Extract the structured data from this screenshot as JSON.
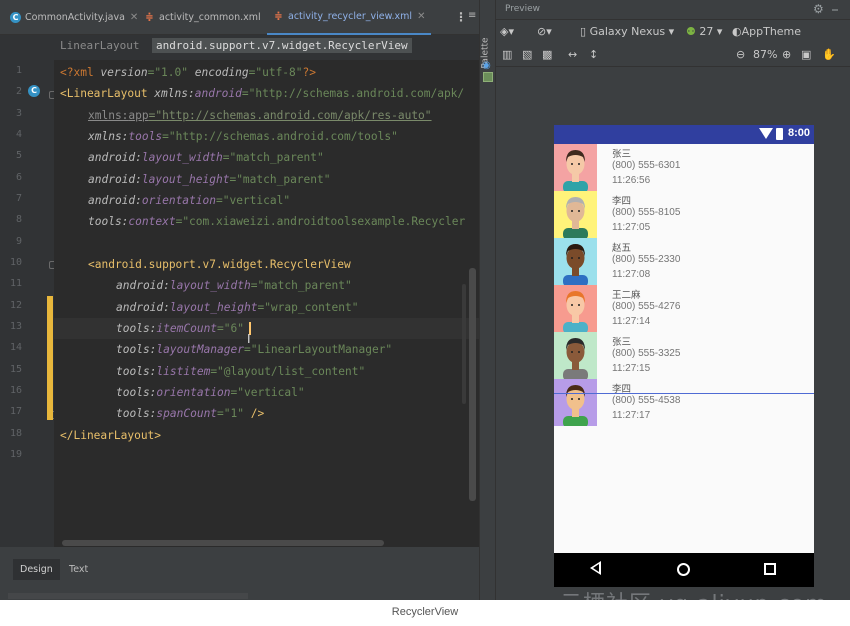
{
  "editor": {
    "tabs": [
      {
        "label": "CommonActivity.java",
        "icon": "java-class-icon"
      },
      {
        "label": "activity_common.xml",
        "icon": "layout-xml-icon"
      },
      {
        "label": "activity_recycler_view.xml",
        "icon": "layout-xml-icon",
        "active": true
      }
    ],
    "breadcrumb": [
      "LinearLayout",
      "android.support.v7.widget.RecyclerView"
    ],
    "line_numbers": [
      "1",
      "2",
      "3",
      "4",
      "5",
      "6",
      "7",
      "8",
      "9",
      "10",
      "11",
      "12",
      "13",
      "14",
      "15",
      "16",
      "17",
      "18",
      "19"
    ],
    "code": {
      "l1_pi": "<?xml ",
      "l1_a1": "version",
      "l1_v1": "=\"1.0\" ",
      "l1_a2": "encoding",
      "l1_v2": "=\"utf-8\"",
      "l1_end": "?>",
      "l2_tag": "<LinearLayout ",
      "l2_ns": "xmlns:",
      "l2_attr": "android",
      "l2_val": "=\"http://schemas.android.com/apk/",
      "l3_ns": "xmlns:",
      "l3_attr": "app",
      "l3_val": "=\"http://schemas.android.com/apk/res-auto\"",
      "l4_ns": "xmlns:",
      "l4_attr": "tools",
      "l4_val": "=\"http://schemas.android.com/tools\"",
      "l5_ns": "android:",
      "l5_attr": "layout_width",
      "l5_val": "=\"match_parent\"",
      "l6_ns": "android:",
      "l6_attr": "layout_height",
      "l6_val": "=\"match_parent\"",
      "l7_ns": "android:",
      "l7_attr": "orientation",
      "l7_val": "=\"vertical\"",
      "l8_ns": "tools:",
      "l8_attr": "context",
      "l8_val": "=\"com.xiaweizi.androidtoolsexample.Recycler",
      "l10_tag": "<android.support.v7.widget.RecyclerView",
      "l11_ns": "android:",
      "l11_attr": "layout_width",
      "l11_val": "=\"match_parent\"",
      "l12_ns": "android:",
      "l12_attr": "layout_height",
      "l12_val": "=\"wrap_content\"",
      "l13_ns": "tools:",
      "l13_attr": "itemCount",
      "l13_val": "=\"6\"",
      "l14_ns": "tools:",
      "l14_attr": "layoutManager",
      "l14_val": "=\"LinearLayoutManager\"",
      "l15_ns": "tools:",
      "l15_attr": "listitem",
      "l15_val": "=\"@layout/list_content\"",
      "l16_ns": "tools:",
      "l16_attr": "orientation",
      "l16_val": "=\"vertical\"",
      "l17_ns": "tools:",
      "l17_attr": "spanCount",
      "l17_val": "=\"1\"",
      "l17_end": " />",
      "l18_tag": "</LinearLayout>"
    },
    "bottom_tabs": [
      "Design",
      "Text"
    ]
  },
  "palette": {
    "label": "Palette",
    "icon": "eye-icon"
  },
  "preview": {
    "title": "Preview",
    "device": "Galaxy Nexus",
    "api_level": "27",
    "theme": "AppTheme",
    "zoom": "87%",
    "status_time": "8:00",
    "list": [
      {
        "name": "张三",
        "phone": "(800) 555-6301",
        "time": "11:26:56",
        "bg": "#f4a3a3",
        "skin": "#f5c9a7",
        "hair": "#3e2a1e",
        "shirt": "#2ea3a8"
      },
      {
        "name": "李四",
        "phone": "(800) 555-8105",
        "time": "11:27:05",
        "bg": "#fff37a",
        "skin": "#e0b896",
        "hair": "#b0b0b0",
        "shirt": "#2c7a5b"
      },
      {
        "name": "赵五",
        "phone": "(800) 555-2330",
        "time": "11:27:08",
        "bg": "#9be0ec",
        "skin": "#7a4b2a",
        "hair": "#2a1a10",
        "shirt": "#2e6fc2"
      },
      {
        "name": "王二麻",
        "phone": "(800) 555-4276",
        "time": "11:27:14",
        "bg": "#f79b8f",
        "skin": "#f8c8a6",
        "hair": "#e8762a",
        "shirt": "#4cb1c8"
      },
      {
        "name": "张三",
        "phone": "(800) 555-3325",
        "time": "11:27:15",
        "bg": "#bfe8c9",
        "skin": "#8a5a3a",
        "hair": "#2a2a2a",
        "shirt": "#7a7a7a"
      },
      {
        "name": "李四",
        "phone": "(800) 555-4538",
        "time": "11:27:17",
        "bg": "#b79ce8",
        "skin": "#f1c08c",
        "hair": "#4a2c16",
        "shirt": "#3fa34d"
      }
    ]
  },
  "watermark": "云栖社区 yq.aliyun.com",
  "caption": "RecyclerView"
}
